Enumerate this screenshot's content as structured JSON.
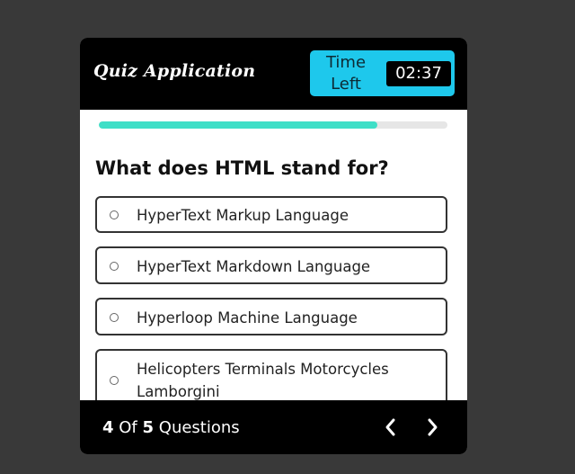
{
  "header": {
    "app_title": "Quiz Application",
    "timer_label": "Time Left",
    "timer_value": "02:37"
  },
  "progress": {
    "fraction": 0.8
  },
  "question": {
    "text": "What does HTML stand for?",
    "options": [
      {
        "label": "HyperText Markup Language"
      },
      {
        "label": "HyperText Markdown Language"
      },
      {
        "label": "Hyperloop Machine Language"
      },
      {
        "label": "Helicopters Terminals Motorcycles Lamborgini"
      }
    ]
  },
  "footer": {
    "current": "4",
    "of_text": "Of",
    "total": "5",
    "questions_text": "Questions",
    "prev_icon": "chevron-left-icon",
    "next_icon": "chevron-right-icon"
  },
  "colors": {
    "page_background": "#393939",
    "header_background": "#000000",
    "timer_background": "#1ec8ec",
    "progress_fill": "#3fdfc7",
    "progress_track": "#e6e6e6"
  }
}
